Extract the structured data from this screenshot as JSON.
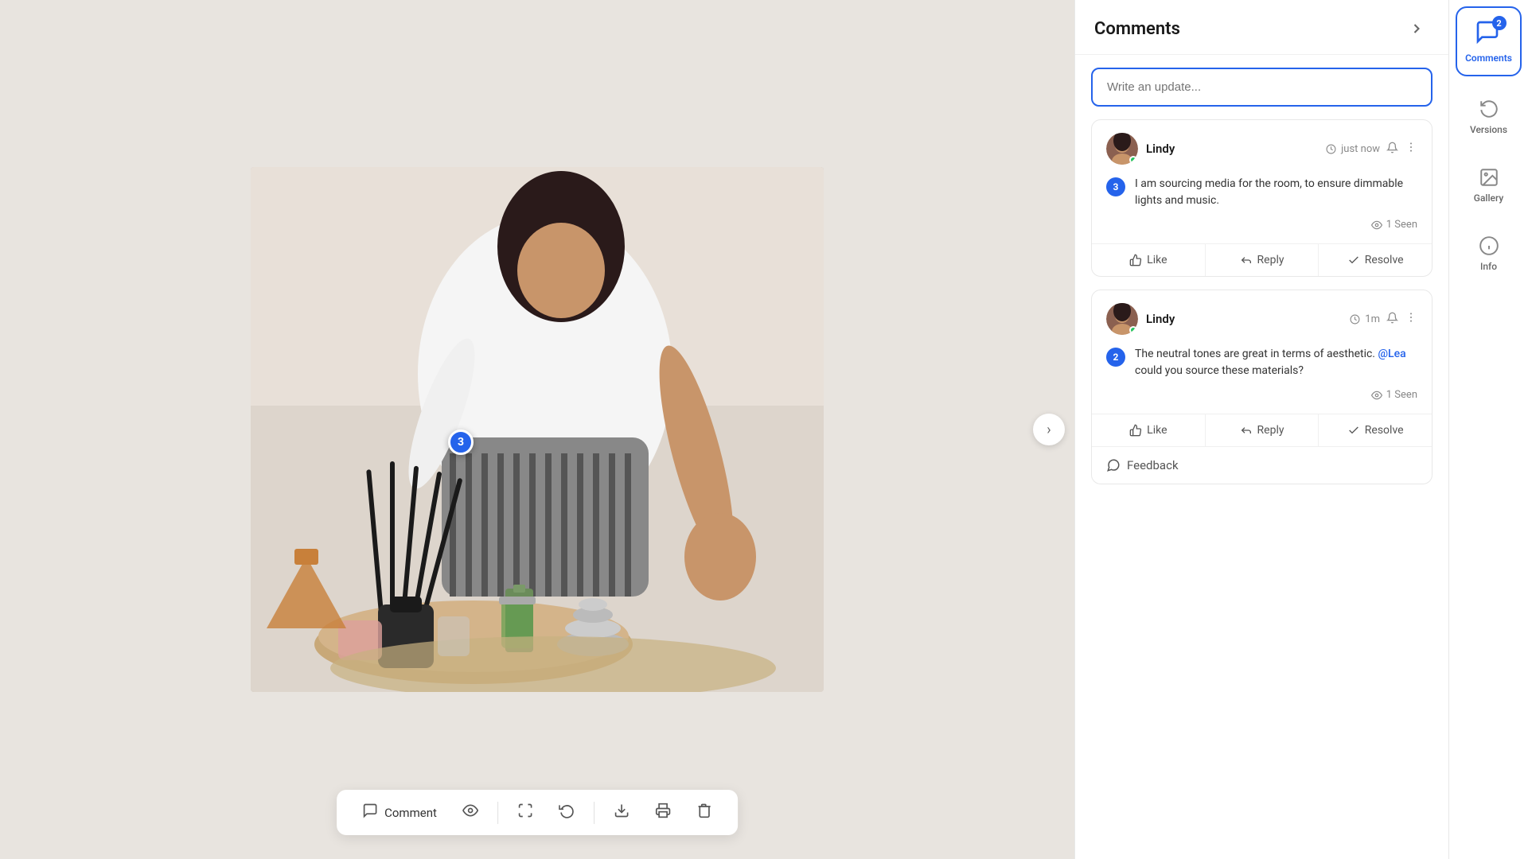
{
  "image": {
    "alt": "Meditation room with candles and stones",
    "annotation3_label": "3"
  },
  "toolbar": {
    "comment_label": "Comment",
    "comment_icon": "💬",
    "visibility_icon": "👁",
    "expand_icon": "⛶",
    "rotate_icon": "↻",
    "download_icon": "↓",
    "print_icon": "🖨",
    "delete_icon": "🗑"
  },
  "comments": {
    "title": "Comments",
    "close_icon": "›",
    "write_placeholder": "Write an update...",
    "items": [
      {
        "id": 1,
        "user": "Lindy",
        "online": true,
        "time": "just now",
        "number": 3,
        "text": "I am sourcing media for the room, to ensure dimmable lights and music.",
        "seen_count": "1 Seen",
        "like_label": "Like",
        "reply_label": "Reply",
        "resolve_label": "Resolve"
      },
      {
        "id": 2,
        "user": "Lindy",
        "online": true,
        "time": "1m",
        "number": 2,
        "text_before": "The neutral tones are great in terms of aesthetic. ",
        "mention": "@Lea",
        "text_after": " could you source these materials?",
        "seen_count": "1 Seen",
        "like_label": "Like",
        "reply_label": "Reply",
        "resolve_label": "Resolve",
        "feedback_label": "Feedback"
      }
    ]
  },
  "sidebar": {
    "comments_label": "Comments",
    "badge_count": "2",
    "versions_label": "Versions",
    "gallery_label": "Gallery",
    "info_label": "Info"
  }
}
